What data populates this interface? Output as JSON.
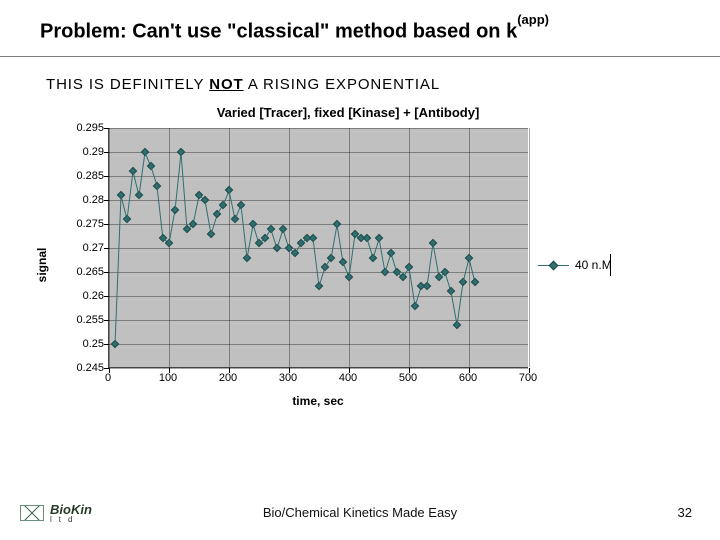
{
  "title_prefix": "Problem: Can't use \"classical\" method based on k",
  "title_sup": "(app)",
  "subtitle_prefix": "THIS IS DEFINITELY ",
  "subtitle_not": "NOT",
  "subtitle_suffix": " A RISING EXPONENTIAL",
  "legend_label": "40 n.M",
  "footer": "Bio/Chemical Kinetics Made Easy",
  "slide_no": "32",
  "logo_text": "BioKin",
  "logo_sub": "l t d",
  "chart_data": {
    "type": "line",
    "title": "Varied [Tracer], fixed [Kinase] + [Antibody]",
    "xlabel": "time, sec",
    "ylabel": "signal",
    "xlim": [
      0,
      700
    ],
    "ylim": [
      0.245,
      0.295
    ],
    "x_ticks": [
      0,
      100,
      200,
      300,
      400,
      500,
      600,
      700
    ],
    "y_ticks": [
      0.245,
      0.25,
      0.255,
      0.26,
      0.265,
      0.27,
      0.275,
      0.28,
      0.285,
      0.29,
      0.295
    ],
    "series": [
      {
        "name": "40 n.M",
        "color": "#2f6f6f",
        "x": [
          10,
          20,
          30,
          40,
          50,
          60,
          70,
          80,
          90,
          100,
          110,
          120,
          130,
          140,
          150,
          160,
          170,
          180,
          190,
          200,
          210,
          220,
          230,
          240,
          250,
          260,
          270,
          280,
          290,
          300,
          310,
          320,
          330,
          340,
          350,
          360,
          370,
          380,
          390,
          400,
          410,
          420,
          430,
          440,
          450,
          460,
          470,
          480,
          490,
          500,
          510,
          520,
          530,
          540,
          550,
          560,
          570,
          580,
          590,
          600,
          610
        ],
        "y": [
          0.25,
          0.281,
          0.276,
          0.286,
          0.281,
          0.29,
          0.287,
          0.283,
          0.272,
          0.271,
          0.278,
          0.29,
          0.274,
          0.275,
          0.281,
          0.28,
          0.273,
          0.277,
          0.279,
          0.282,
          0.276,
          0.279,
          0.268,
          0.275,
          0.271,
          0.272,
          0.274,
          0.27,
          0.274,
          0.27,
          0.269,
          0.271,
          0.272,
          0.272,
          0.262,
          0.266,
          0.268,
          0.275,
          0.267,
          0.264,
          0.273,
          0.272,
          0.272,
          0.268,
          0.272,
          0.265,
          0.269,
          0.265,
          0.264,
          0.266,
          0.258,
          0.262,
          0.262,
          0.271,
          0.264,
          0.265,
          0.261,
          0.254,
          0.263,
          0.268,
          0.263
        ]
      }
    ]
  }
}
